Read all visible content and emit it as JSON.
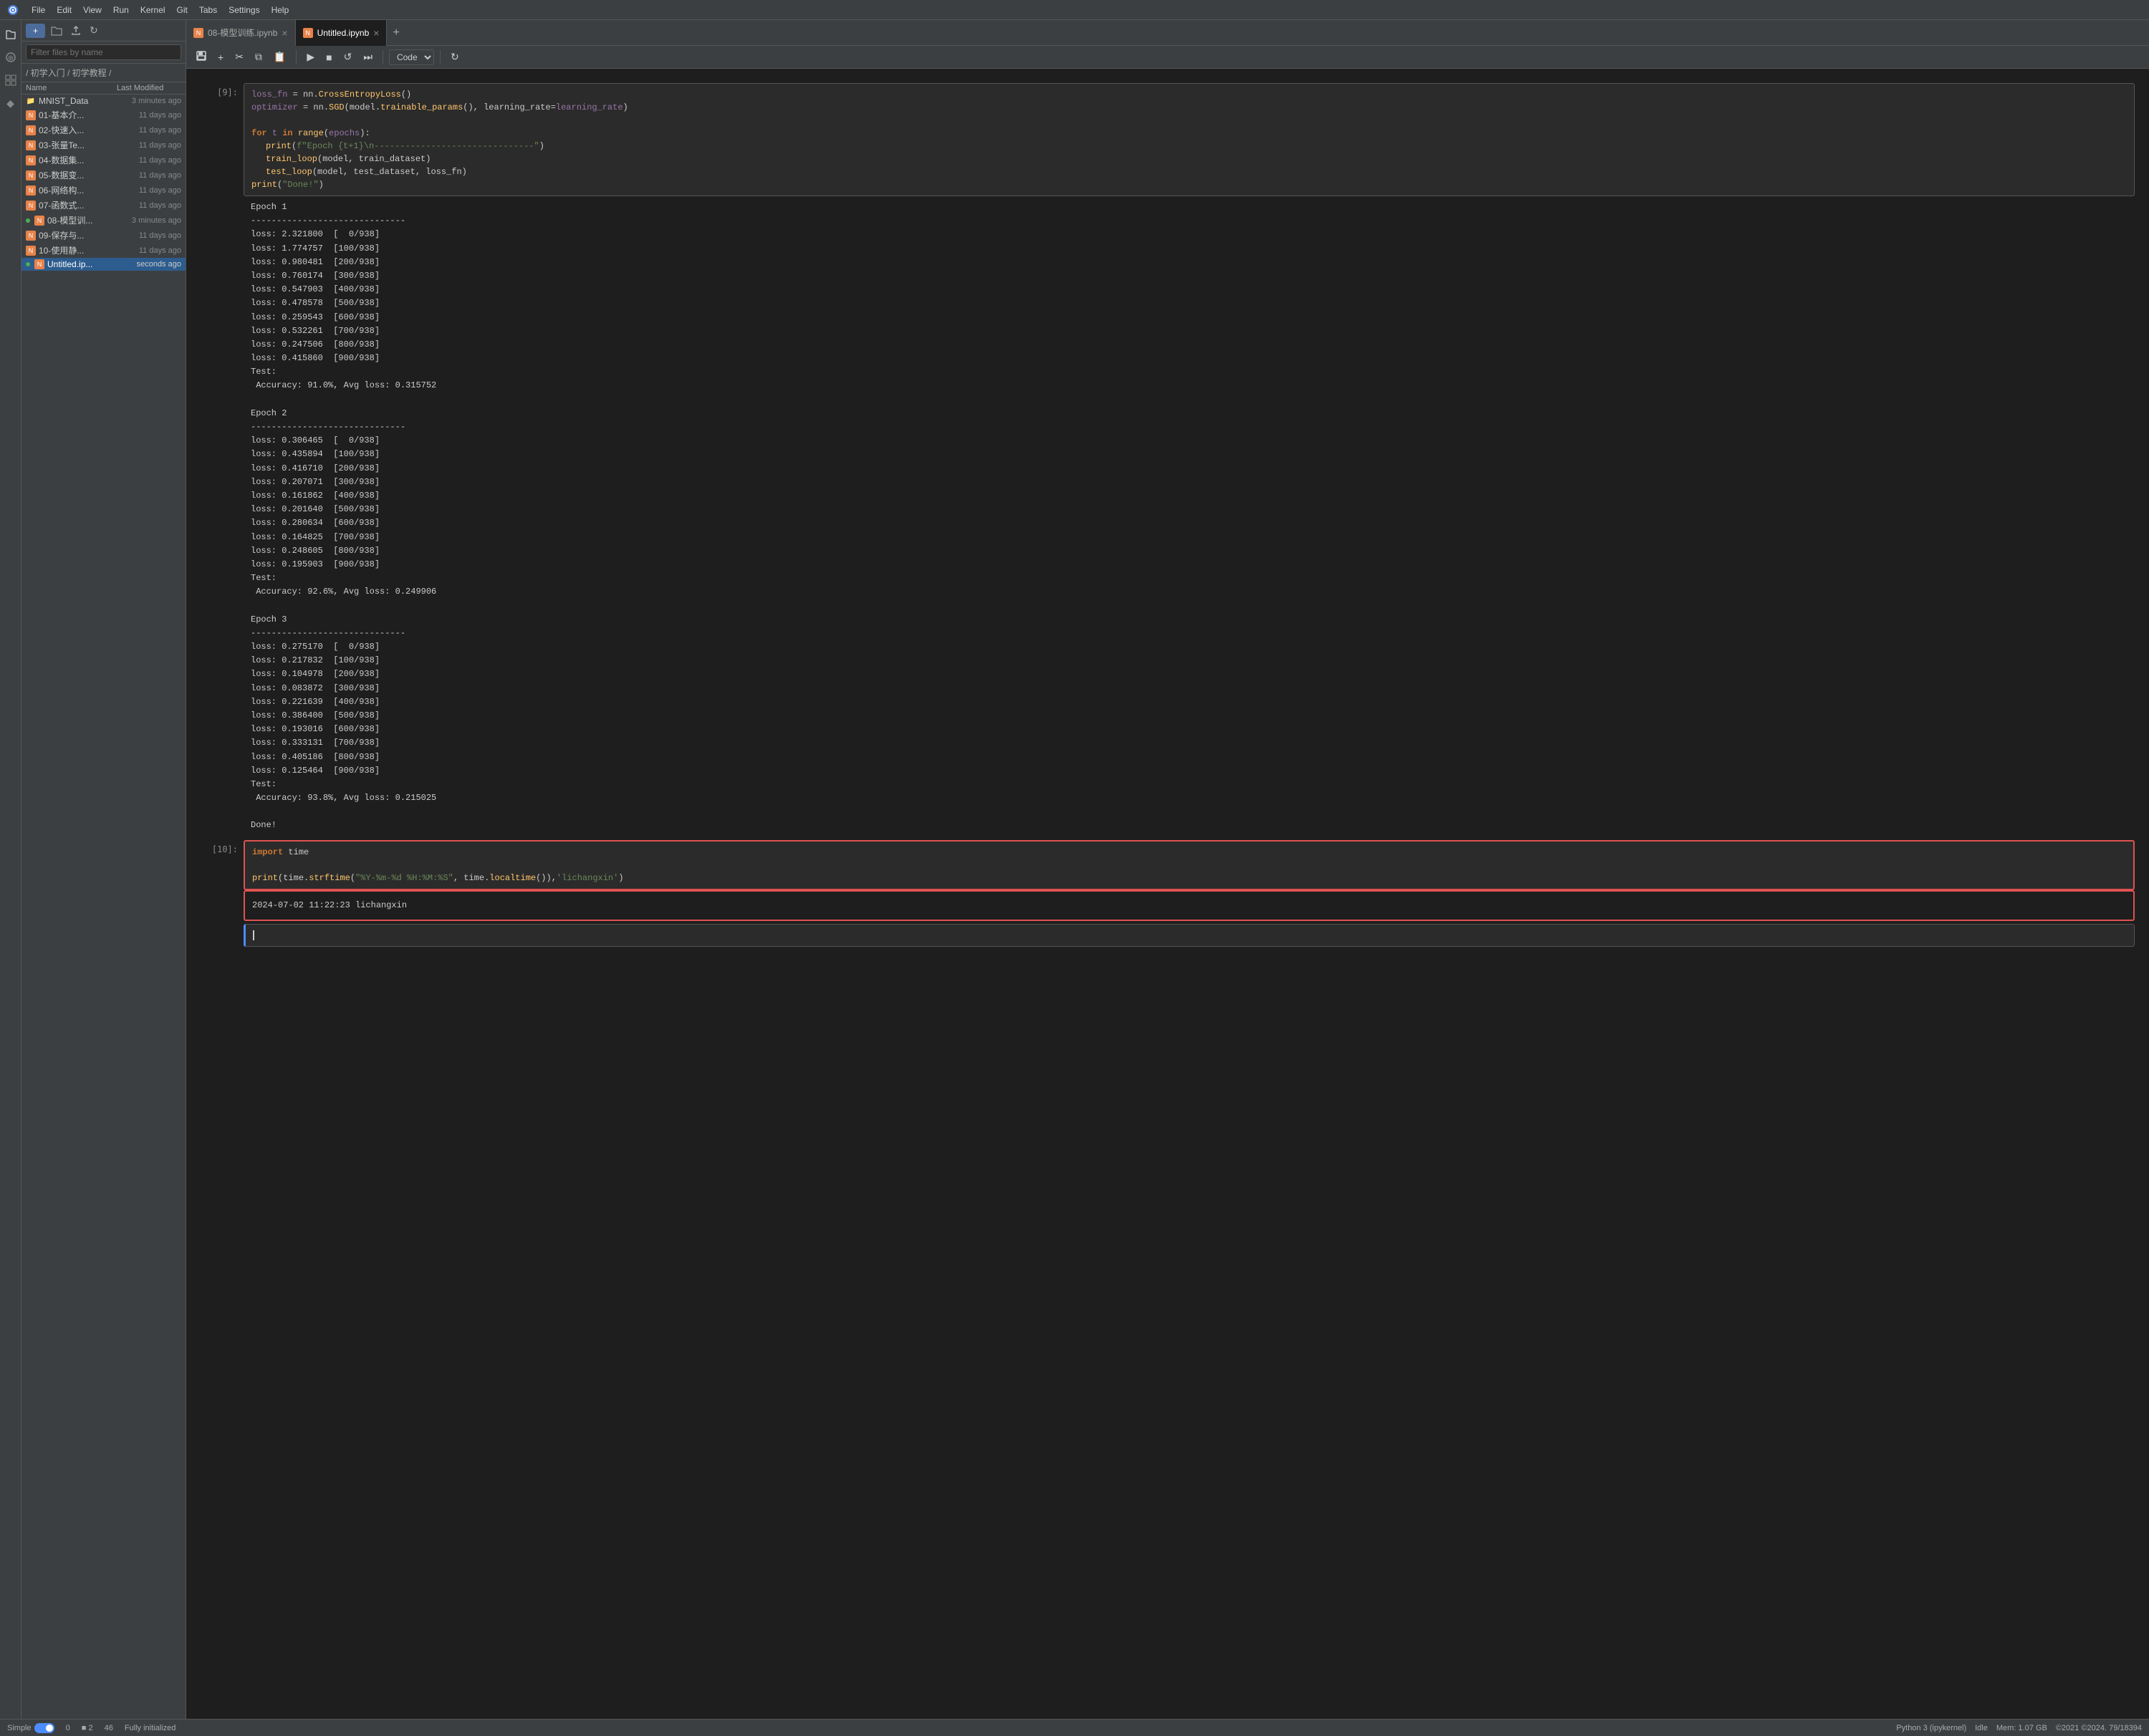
{
  "menubar": {
    "items": [
      "File",
      "Edit",
      "View",
      "Run",
      "Kernel",
      "Git",
      "Tabs",
      "Settings",
      "Help"
    ]
  },
  "search": {
    "placeholder": "Filter files by name"
  },
  "breadcrumb": "/ 初学入门 / 初学教程 /",
  "file_list": {
    "headers": [
      "Name",
      "Last Modified"
    ],
    "files": [
      {
        "name": "MNIST_Data",
        "type": "folder",
        "modified": "3 minutes ago",
        "running": false
      },
      {
        "name": "01-基本介...",
        "type": "notebook",
        "modified": "11 days ago",
        "running": false
      },
      {
        "name": "02-快速入...",
        "type": "notebook",
        "modified": "11 days ago",
        "running": false
      },
      {
        "name": "03-张量Te...",
        "type": "notebook",
        "modified": "11 days ago",
        "running": false
      },
      {
        "name": "04-数据集...",
        "type": "notebook",
        "modified": "11 days ago",
        "running": false
      },
      {
        "name": "05-数据变...",
        "type": "notebook",
        "modified": "11 days ago",
        "running": false
      },
      {
        "name": "06-网络构...",
        "type": "notebook",
        "modified": "11 days ago",
        "running": false
      },
      {
        "name": "07-函数式...",
        "type": "notebook",
        "modified": "11 days ago",
        "running": false
      },
      {
        "name": "08-模型训...",
        "type": "notebook",
        "modified": "3 minutes ago",
        "running": true
      },
      {
        "name": "09-保存与...",
        "type": "notebook",
        "modified": "11 days ago",
        "running": false
      },
      {
        "name": "10-使用静...",
        "type": "notebook",
        "modified": "11 days ago",
        "running": false
      },
      {
        "name": "Untitled.ip...",
        "type": "notebook",
        "modified": "seconds ago",
        "running": true,
        "active": true
      }
    ]
  },
  "tabs": [
    {
      "label": "08-模型训练.ipynb",
      "active": false
    },
    {
      "label": "Untitled.ipynb",
      "active": true
    }
  ],
  "cell_type": "Code",
  "cells": {
    "c9": {
      "prompt": "[9]:",
      "code_lines": [
        "loss_fn = nn.CrossEntropyLoss()",
        "optimizer = nn.SGD(model.trainable_params(), learning_rate=learning_rate)",
        "",
        "for t in range(epochs):",
        "    print(f\"Epoch {t+1}\\n-------------------------------\")",
        "    train_loop(model, train_dataset)",
        "    test_loop(model, test_dataset, loss_fn)",
        "print(\"Done!\")"
      ],
      "output": "Epoch 1\n-------------------------------\nloss: 2.321800  [  0/938]\nloss: 1.774757  [100/938]\nloss: 0.980481  [200/938]\nloss: 0.760174  [300/938]\nloss: 0.547903  [400/938]\nloss: 0.478578  [500/938]\nloss: 0.259543  [600/938]\nloss: 0.532261  [700/938]\nloss: 0.247506  [800/938]\nloss: 0.415860  [900/938]\nTest:\n Accuracy: 91.0%, Avg loss: 0.315752\n\nEpoch 2\n-------------------------------\nloss: 0.306465  [  0/938]\nloss: 0.435894  [100/938]\nloss: 0.416710  [200/938]\nloss: 0.207071  [300/938]\nloss: 0.161862  [400/938]\nloss: 0.201640  [500/938]\nloss: 0.280634  [600/938]\nloss: 0.164825  [700/938]\nloss: 0.248605  [800/938]\nloss: 0.195903  [900/938]\nTest:\n Accuracy: 92.6%, Avg loss: 0.249906\n\nEpoch 3\n-------------------------------\nloss: 0.275170  [  0/938]\nloss: 0.217832  [100/938]\nloss: 0.104978  [200/938]\nloss: 0.083872  [300/938]\nloss: 0.221639  [400/938]\nloss: 0.386400  [500/938]\nloss: 0.193016  [600/938]\nloss: 0.333131  [700/938]\nloss: 0.405186  [800/938]\nloss: 0.125464  [900/938]\nTest:\n Accuracy: 93.8%, Avg loss: 0.215025\n\nDone!"
    },
    "c10": {
      "prompt": "[10]:",
      "code_lines": [
        "import time",
        "",
        "print(time.strftime(\"%Y-%m-%d %H:%M:%S\", time.localtime()),'lichangxin')"
      ],
      "output": "2024-07-02 11:22:23 lichangxin"
    }
  },
  "statusbar": {
    "mode": "Simple",
    "num1": "0",
    "num2": "2",
    "num3": "46",
    "initialized": "Fully initialized",
    "kernel": "Python 3 (ipykernel)",
    "kernel_status": "Idle",
    "memory": "Mem: 1.07 GB",
    "bottom_right": "©2021 ©2024. 79/18394"
  }
}
